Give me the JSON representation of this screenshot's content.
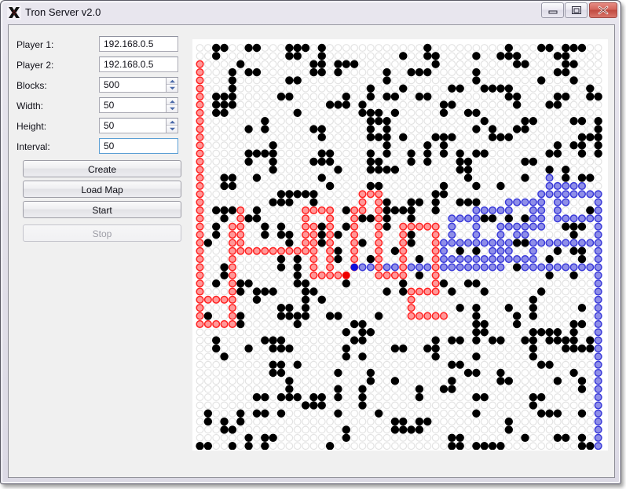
{
  "window": {
    "title": "Tron Server v2.0",
    "icon": "tron-x-icon",
    "controls": {
      "minimize": "minimize-icon",
      "maximize": "maximize-icon",
      "close": "close-icon"
    }
  },
  "form": {
    "fields": [
      {
        "label": "Player 1:",
        "value": "192.168.0.5",
        "type": "text",
        "focused": false
      },
      {
        "label": "Player 2:",
        "value": "192.168.0.5",
        "type": "text",
        "focused": false
      },
      {
        "label": "Blocks:",
        "value": "500",
        "type": "spinner",
        "focused": false
      },
      {
        "label": "Width:",
        "value": "50",
        "type": "spinner",
        "focused": false
      },
      {
        "label": "Height:",
        "value": "50",
        "type": "spinner",
        "focused": false
      },
      {
        "label": "Interval:",
        "value": "50",
        "type": "text",
        "focused": true
      }
    ]
  },
  "buttons": [
    {
      "label": "Create",
      "enabled": true
    },
    {
      "label": "Load Map",
      "enabled": true
    },
    {
      "label": "Start",
      "enabled": true
    },
    {
      "label": "Stop",
      "enabled": false
    }
  ],
  "board": {
    "cols": 50,
    "rows": 50,
    "cell_size": 10.35,
    "colors": {
      "empty_stroke": "#e3e3e3",
      "block": "#000000",
      "player1_fill": "#ff9999",
      "player1_stroke": "#ff2222",
      "player1_head": "#ee0000",
      "player2_fill": "#8f8fe8",
      "player2_stroke": "#3a3ad8",
      "player2_head": "#1111dd",
      "background": "#ffffff"
    },
    "player1_head_cell": [
      18,
      28
    ],
    "player2_head_cell": [
      19,
      27
    ],
    "player1_trail": [
      [
        0,
        2
      ],
      [
        0,
        3
      ],
      [
        0,
        4
      ],
      [
        0,
        5
      ],
      [
        0,
        6
      ],
      [
        0,
        7
      ],
      [
        0,
        8
      ],
      [
        0,
        9
      ],
      [
        0,
        10
      ],
      [
        0,
        11
      ],
      [
        0,
        12
      ],
      [
        0,
        13
      ],
      [
        0,
        14
      ],
      [
        0,
        15
      ],
      [
        0,
        16
      ],
      [
        0,
        17
      ],
      [
        0,
        18
      ],
      [
        0,
        19
      ],
      [
        0,
        20
      ],
      [
        0,
        21
      ],
      [
        0,
        22
      ],
      [
        0,
        23
      ],
      [
        0,
        24
      ],
      [
        0,
        25
      ],
      [
        0,
        26
      ],
      [
        0,
        27
      ],
      [
        0,
        28
      ],
      [
        0,
        29
      ],
      [
        0,
        30
      ],
      [
        0,
        31
      ],
      [
        1,
        31
      ],
      [
        2,
        31
      ],
      [
        3,
        31
      ],
      [
        4,
        31
      ],
      [
        4,
        30
      ],
      [
        4,
        29
      ],
      [
        4,
        28
      ],
      [
        4,
        27
      ],
      [
        4,
        26
      ],
      [
        4,
        25
      ],
      [
        5,
        25
      ],
      [
        6,
        25
      ],
      [
        7,
        25
      ],
      [
        8,
        25
      ],
      [
        9,
        25
      ],
      [
        10,
        25
      ],
      [
        11,
        25
      ],
      [
        12,
        25
      ],
      [
        13,
        25
      ],
      [
        13,
        24
      ],
      [
        13,
        23
      ],
      [
        13,
        22
      ],
      [
        13,
        21
      ],
      [
        13,
        20
      ],
      [
        14,
        20
      ],
      [
        15,
        20
      ],
      [
        16,
        20
      ],
      [
        16,
        21
      ],
      [
        16,
        22
      ],
      [
        16,
        23
      ],
      [
        16,
        24
      ],
      [
        16,
        25
      ],
      [
        16,
        26
      ],
      [
        16,
        27
      ],
      [
        16,
        28
      ],
      [
        15,
        28
      ],
      [
        14,
        28
      ],
      [
        14,
        27
      ],
      [
        14,
        26
      ],
      [
        14,
        25
      ],
      [
        14,
        24
      ],
      [
        14,
        23
      ],
      [
        14,
        22
      ],
      [
        17,
        28
      ],
      [
        18,
        28
      ],
      [
        4,
        24
      ],
      [
        4,
        23
      ],
      [
        4,
        22
      ],
      [
        4,
        32
      ],
      [
        4,
        33
      ],
      [
        4,
        34
      ],
      [
        3,
        34
      ],
      [
        2,
        34
      ],
      [
        1,
        34
      ],
      [
        0,
        34
      ],
      [
        0,
        33
      ],
      [
        0,
        32
      ],
      [
        5,
        20
      ],
      [
        5,
        21
      ],
      [
        5,
        22
      ],
      [
        5,
        23
      ],
      [
        5,
        24
      ],
      [
        19,
        20
      ],
      [
        19,
        21
      ],
      [
        19,
        22
      ],
      [
        19,
        23
      ],
      [
        19,
        24
      ],
      [
        19,
        25
      ],
      [
        19,
        26
      ],
      [
        19,
        27
      ],
      [
        20,
        20
      ],
      [
        20,
        19
      ],
      [
        20,
        18
      ],
      [
        21,
        18
      ],
      [
        22,
        18
      ],
      [
        22,
        19
      ],
      [
        22,
        20
      ],
      [
        22,
        21
      ],
      [
        22,
        22
      ],
      [
        22,
        23
      ],
      [
        22,
        24
      ],
      [
        22,
        25
      ],
      [
        22,
        26
      ],
      [
        22,
        27
      ],
      [
        22,
        28
      ],
      [
        23,
        28
      ],
      [
        24,
        28
      ],
      [
        25,
        28
      ],
      [
        25,
        27
      ],
      [
        25,
        26
      ],
      [
        25,
        25
      ],
      [
        25,
        24
      ],
      [
        25,
        23
      ],
      [
        25,
        22
      ],
      [
        26,
        22
      ],
      [
        27,
        22
      ],
      [
        28,
        22
      ],
      [
        29,
        22
      ],
      [
        29,
        23
      ],
      [
        29,
        24
      ],
      [
        29,
        25
      ],
      [
        29,
        26
      ],
      [
        29,
        27
      ],
      [
        29,
        28
      ],
      [
        29,
        29
      ],
      [
        29,
        30
      ],
      [
        28,
        30
      ],
      [
        27,
        30
      ],
      [
        26,
        30
      ],
      [
        26,
        31
      ],
      [
        26,
        32
      ],
      [
        26,
        33
      ],
      [
        27,
        33
      ],
      [
        28,
        33
      ],
      [
        29,
        33
      ],
      [
        30,
        33
      ]
    ],
    "player2_trail": [
      [
        19,
        27
      ],
      [
        20,
        27
      ],
      [
        21,
        27
      ],
      [
        22,
        27
      ],
      [
        23,
        27
      ],
      [
        24,
        27
      ],
      [
        25,
        27
      ],
      [
        26,
        27
      ],
      [
        27,
        27
      ],
      [
        28,
        27
      ],
      [
        29,
        27
      ],
      [
        30,
        27
      ],
      [
        31,
        27
      ],
      [
        32,
        27
      ],
      [
        33,
        27
      ],
      [
        34,
        27
      ],
      [
        35,
        27
      ],
      [
        36,
        27
      ],
      [
        37,
        27
      ],
      [
        37,
        26
      ],
      [
        37,
        25
      ],
      [
        37,
        24
      ],
      [
        37,
        23
      ],
      [
        37,
        22
      ],
      [
        38,
        22
      ],
      [
        39,
        22
      ],
      [
        40,
        22
      ],
      [
        41,
        22
      ],
      [
        42,
        22
      ],
      [
        42,
        21
      ],
      [
        42,
        20
      ],
      [
        42,
        19
      ],
      [
        42,
        18
      ],
      [
        43,
        18
      ],
      [
        44,
        18
      ],
      [
        45,
        18
      ],
      [
        46,
        18
      ],
      [
        47,
        18
      ],
      [
        48,
        18
      ],
      [
        49,
        18
      ],
      [
        49,
        19
      ],
      [
        49,
        20
      ],
      [
        49,
        21
      ],
      [
        49,
        22
      ],
      [
        49,
        23
      ],
      [
        49,
        24
      ],
      [
        49,
        25
      ],
      [
        49,
        26
      ],
      [
        49,
        27
      ],
      [
        49,
        28
      ],
      [
        49,
        29
      ],
      [
        49,
        30
      ],
      [
        49,
        31
      ],
      [
        49,
        32
      ],
      [
        49,
        33
      ],
      [
        49,
        34
      ],
      [
        49,
        35
      ],
      [
        49,
        36
      ],
      [
        49,
        37
      ],
      [
        49,
        38
      ],
      [
        49,
        39
      ],
      [
        49,
        40
      ],
      [
        49,
        41
      ],
      [
        49,
        42
      ],
      [
        49,
        43
      ],
      [
        49,
        44
      ],
      [
        49,
        45
      ],
      [
        49,
        46
      ],
      [
        49,
        47
      ],
      [
        49,
        48
      ],
      [
        49,
        49
      ],
      [
        43,
        17
      ],
      [
        43,
        16
      ],
      [
        43,
        17
      ],
      [
        44,
        17
      ],
      [
        45,
        17
      ],
      [
        46,
        17
      ],
      [
        47,
        17
      ],
      [
        41,
        24
      ],
      [
        42,
        24
      ],
      [
        43,
        24
      ],
      [
        44,
        24
      ],
      [
        45,
        24
      ],
      [
        46,
        24
      ],
      [
        47,
        24
      ],
      [
        48,
        24
      ],
      [
        41,
        25
      ],
      [
        41,
        26
      ],
      [
        40,
        26
      ],
      [
        39,
        26
      ],
      [
        38,
        26
      ],
      [
        38,
        25
      ],
      [
        38,
        24
      ],
      [
        39,
        23
      ],
      [
        40,
        23
      ],
      [
        36,
        26
      ],
      [
        36,
        25
      ],
      [
        36,
        24
      ],
      [
        35,
        24
      ],
      [
        34,
        24
      ],
      [
        34,
        23
      ],
      [
        34,
        22
      ],
      [
        34,
        21
      ],
      [
        34,
        20
      ],
      [
        35,
        20
      ],
      [
        36,
        20
      ],
      [
        37,
        20
      ],
      [
        38,
        20
      ],
      [
        38,
        19
      ],
      [
        39,
        19
      ],
      [
        40,
        19
      ],
      [
        41,
        19
      ],
      [
        41,
        20
      ],
      [
        41,
        21
      ],
      [
        33,
        21
      ],
      [
        32,
        21
      ],
      [
        31,
        21
      ],
      [
        31,
        22
      ],
      [
        31,
        23
      ],
      [
        31,
        24
      ],
      [
        32,
        24
      ],
      [
        33,
        24
      ],
      [
        30,
        24
      ],
      [
        30,
        25
      ],
      [
        30,
        26
      ],
      [
        31,
        26
      ],
      [
        32,
        26
      ],
      [
        33,
        26
      ],
      [
        34,
        26
      ],
      [
        35,
        26
      ],
      [
        44,
        19
      ],
      [
        45,
        19
      ],
      [
        44,
        20
      ],
      [
        44,
        21
      ],
      [
        45,
        21
      ],
      [
        46,
        21
      ],
      [
        47,
        21
      ],
      [
        48,
        21
      ],
      [
        40,
        27
      ],
      [
        41,
        27
      ],
      [
        42,
        27
      ],
      [
        43,
        27
      ],
      [
        44,
        27
      ],
      [
        45,
        27
      ],
      [
        46,
        27
      ],
      [
        47,
        27
      ],
      [
        48,
        27
      ]
    ]
  }
}
